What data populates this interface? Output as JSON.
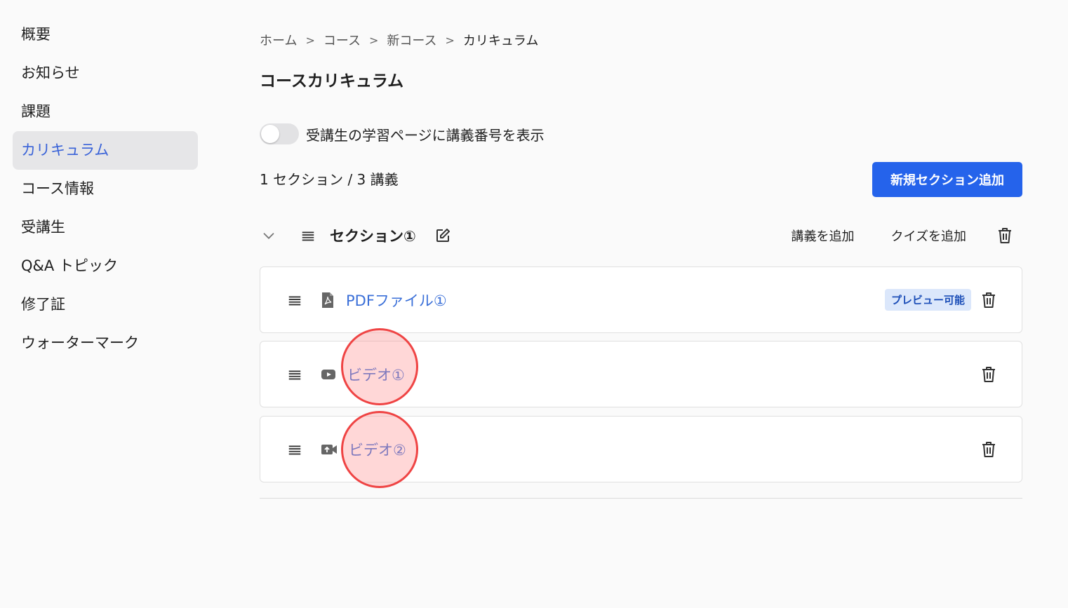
{
  "sidebar": {
    "items": [
      {
        "label": "概要"
      },
      {
        "label": "お知らせ"
      },
      {
        "label": "課題"
      },
      {
        "label": "カリキュラム",
        "active": true
      },
      {
        "label": "コース情報"
      },
      {
        "label": "受講生"
      },
      {
        "label": "Q&A トピック"
      },
      {
        "label": "修了証"
      },
      {
        "label": "ウォーターマーク"
      }
    ]
  },
  "breadcrumb": {
    "items": [
      "ホーム",
      "コース",
      "新コース",
      "カリキュラム"
    ],
    "separator": ">"
  },
  "page": {
    "title": "コースカリキュラム",
    "toggle_label": "受講生の学習ページに講義番号を表示",
    "toggle_on": false,
    "summary": "1 セクション / 3 講義",
    "add_section_button": "新規セクション追加"
  },
  "section": {
    "title": "セクション①",
    "add_lecture_button": "講義を追加",
    "add_quiz_button": "クイズを追加",
    "lectures": [
      {
        "title": "PDFファイル①",
        "icon": "pdf-file-icon",
        "badge": "プレビュー可能"
      },
      {
        "title": "ビデオ①",
        "icon": "youtube-icon"
      },
      {
        "title": "ビデオ②",
        "icon": "video-upload-icon"
      }
    ]
  },
  "colors": {
    "accent": "#2563eb",
    "link": "#3a6fd8",
    "active_bg": "#e6e6e8",
    "marker": "#ef4444"
  }
}
